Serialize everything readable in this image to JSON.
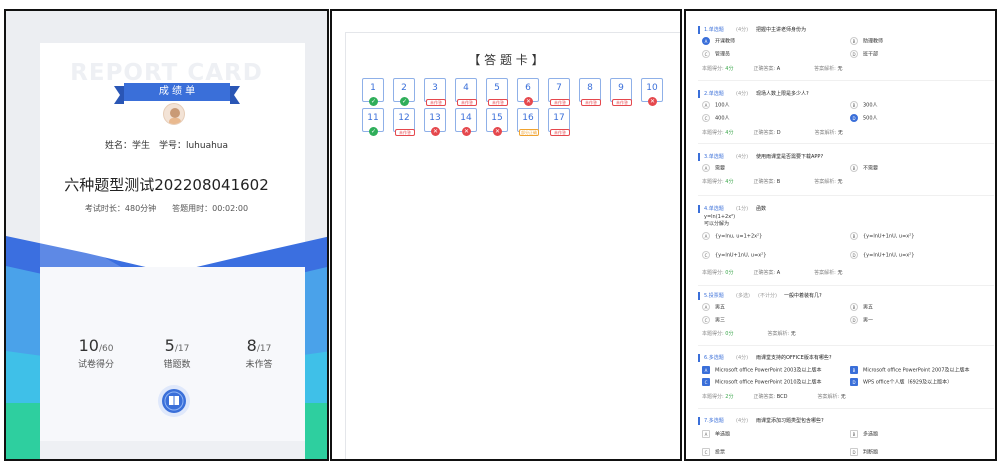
{
  "colors": {
    "accent": "#3a6fd9",
    "correct": "#2fae5a",
    "wrong": "#e5484d",
    "partial": "#f0a32f",
    "unanswered": "#e8a0a0"
  },
  "report": {
    "watermark": "REPORT CARD",
    "ribbon": "成 绩 单",
    "avatar_icon": "student-avatar",
    "name_line": "姓名：学生　学号：luhuahua",
    "exam_title": "六种题型测试202208041602",
    "meta_line": "考试时长：480分钟　　答题用时：00:02:00",
    "stats": [
      {
        "value": "10",
        "total": "/60",
        "label": "试卷得分"
      },
      {
        "value": "5",
        "total": "/17",
        "label": "错题数"
      },
      {
        "value": "8",
        "total": "/17",
        "label": "未作答"
      }
    ],
    "badge_icon": "book-icon"
  },
  "answer_card": {
    "title": "【 答 题 卡 】",
    "items": [
      {
        "num": "1",
        "status": "correct",
        "tag": ""
      },
      {
        "num": "2",
        "status": "correct",
        "tag": ""
      },
      {
        "num": "3",
        "status": "unanswered",
        "tag": "未作答"
      },
      {
        "num": "4",
        "status": "unanswered",
        "tag": "未作答"
      },
      {
        "num": "5",
        "status": "unanswered",
        "tag": "未作答"
      },
      {
        "num": "6",
        "status": "wrong",
        "tag": ""
      },
      {
        "num": "7",
        "status": "unanswered",
        "tag": "未作答"
      },
      {
        "num": "8",
        "status": "unanswered",
        "tag": "未作答"
      },
      {
        "num": "9",
        "status": "unanswered",
        "tag": "未作答"
      },
      {
        "num": "10",
        "status": "wrong",
        "tag": ""
      },
      {
        "num": "11",
        "status": "correct",
        "tag": ""
      },
      {
        "num": "12",
        "status": "unanswered",
        "tag": "未作答"
      },
      {
        "num": "13",
        "status": "wrong",
        "tag": ""
      },
      {
        "num": "14",
        "status": "wrong",
        "tag": ""
      },
      {
        "num": "15",
        "status": "wrong",
        "tag": ""
      },
      {
        "num": "16",
        "status": "partial",
        "tag": "部分正确"
      },
      {
        "num": "17",
        "status": "unanswered",
        "tag": "未作答"
      }
    ]
  },
  "questions": {
    "q1": {
      "type": "1.单选题",
      "score": "(4分)",
      "text": "把握中主讲老师身份为",
      "opts": [
        [
          "A",
          "开课教师"
        ],
        [
          "B",
          "助理教师"
        ],
        [
          "C",
          "管理员"
        ],
        [
          "D",
          "班干部"
        ]
      ],
      "meta": {
        "l1": "本题得分:",
        "v1": "4分",
        "l2": "正确答案:",
        "v2": "A",
        "l3": "答案解析:",
        "v3": "无"
      }
    },
    "q2": {
      "type": "2.单选题",
      "score": "(4分)",
      "text": "现场人数上限是多少人?",
      "opts": [
        [
          "A",
          "100人"
        ],
        [
          "B",
          "300人"
        ],
        [
          "C",
          "400人"
        ],
        [
          "D",
          "500人"
        ]
      ],
      "meta": {
        "l1": "本题得分:",
        "v1": "4分",
        "l2": "正确答案:",
        "v2": "D",
        "l3": "答案解析:",
        "v3": "无"
      }
    },
    "q3": {
      "type": "3.单选题",
      "score": "(4分)",
      "text": "使用雨课堂是否需要下载APP?",
      "opts": [
        [
          "A",
          "需要"
        ],
        [
          "B",
          "不需要"
        ]
      ],
      "meta": {
        "l1": "本题得分:",
        "v1": "4分",
        "l2": "正确答案:",
        "v2": "B",
        "l3": "答案解析:",
        "v3": "无"
      }
    },
    "q4": {
      "type": "4.单选题",
      "score": "(1分)",
      "text": "函数",
      "sub1": "y=ln(1+2x²)",
      "sub2": "可以分解为",
      "opts": [
        [
          "A",
          "{y=lnu, u=1+2x²}"
        ],
        [
          "B",
          "{y=lnU+1nU, u=x²}"
        ],
        [
          "C",
          "{y=lnU+1nU, u=x²}"
        ],
        [
          "D",
          "{y=lnU+1nU, u=x²}"
        ]
      ],
      "meta": {
        "l1": "本题得分:",
        "v1": "0分",
        "l2": "正确答案:",
        "v2": "A",
        "l3": "答案解析:",
        "v3": "无"
      }
    },
    "q5": {
      "type": "5.投票题",
      "score": "(多选)",
      "score2": "(不计分)",
      "text": "一般中着装有几?",
      "opts": [
        [
          "A",
          "男五"
        ],
        [
          "B",
          "男五"
        ],
        [
          "C",
          "男三"
        ],
        [
          "D",
          "男一"
        ]
      ],
      "meta": {
        "l1": "本题得分:",
        "v1": "0分",
        "l3": "答案解析:",
        "v3": "无"
      }
    },
    "q6": {
      "type": "6.多选题",
      "score": "(4分)",
      "text": "雨课堂支持的OFFICE版本有哪些?",
      "opts": [
        [
          "A",
          "Microsoft office PowerPoint 2003及以上版本"
        ],
        [
          "B",
          "Microsoft office PowerPoint 2007及以上版本"
        ],
        [
          "C",
          "Microsoft office PowerPoint 2010及以上版本"
        ],
        [
          "D",
          "WPS office个人版（6929及以上版本）"
        ]
      ],
      "meta": {
        "l1": "本题得分:",
        "v1": "2分",
        "l2": "正确答案:",
        "v2": "BCD",
        "l3": "答案解析:",
        "v3": "无"
      }
    },
    "q7": {
      "type": "7.多选题",
      "score": "(4分)",
      "text": "雨课堂添加习题类型包含哪些?",
      "opts": [
        [
          "A",
          "单选题"
        ],
        [
          "B",
          "多选题"
        ],
        [
          "C",
          "投票"
        ],
        [
          "D",
          "判断题"
        ]
      ]
    }
  }
}
